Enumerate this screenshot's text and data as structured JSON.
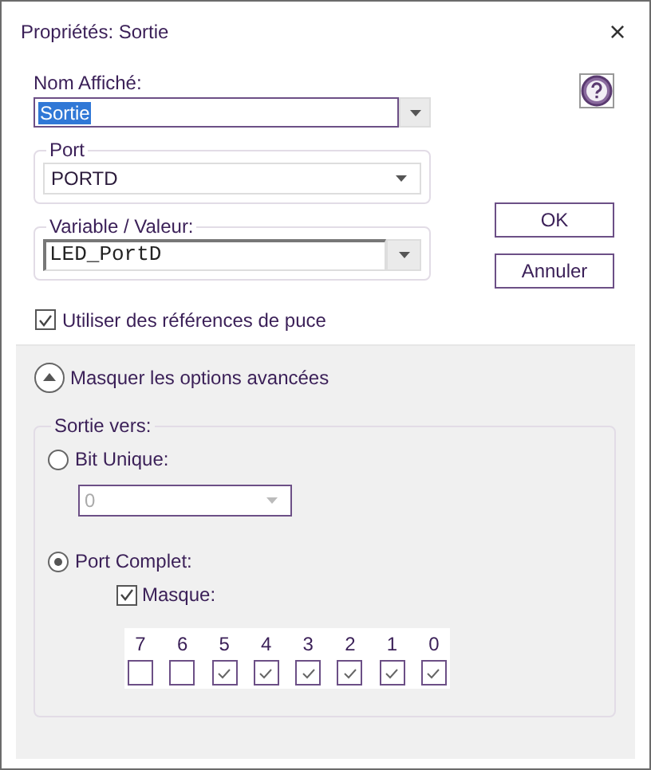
{
  "window": {
    "title": "Propriétés: Sortie",
    "close": "×"
  },
  "display_name": {
    "label": "Nom Affiché:",
    "value": "Sortie",
    "selected": true
  },
  "port": {
    "label": "Port",
    "value": "PORTD"
  },
  "variable": {
    "label": "Variable / Valeur:",
    "value": "LED_PortD"
  },
  "use_chip_refs": {
    "label": "Utiliser des références de puce",
    "checked": true
  },
  "buttons": [
    {
      "label": "OK"
    },
    {
      "label": "Annuler"
    }
  ],
  "advanced": {
    "toggle": "Masquer les options avancées",
    "expanded": true,
    "output": {
      "label": "Sortie vers:",
      "options": [
        {
          "label": "Bit Unique:",
          "selected": false
        },
        {
          "label": "Port Complet:",
          "selected": true
        }
      ],
      "bit_select": {
        "value": "0",
        "disabled": true
      },
      "mask": {
        "label": "Masque:",
        "checked": true,
        "bits": [
          {
            "label": "7",
            "checked": false
          },
          {
            "label": "6",
            "checked": false
          },
          {
            "label": "5",
            "checked": true
          },
          {
            "label": "4",
            "checked": true
          },
          {
            "label": "3",
            "checked": true
          },
          {
            "label": "2",
            "checked": true
          },
          {
            "label": "1",
            "checked": true
          },
          {
            "label": "0",
            "checked": true
          }
        ]
      }
    }
  }
}
